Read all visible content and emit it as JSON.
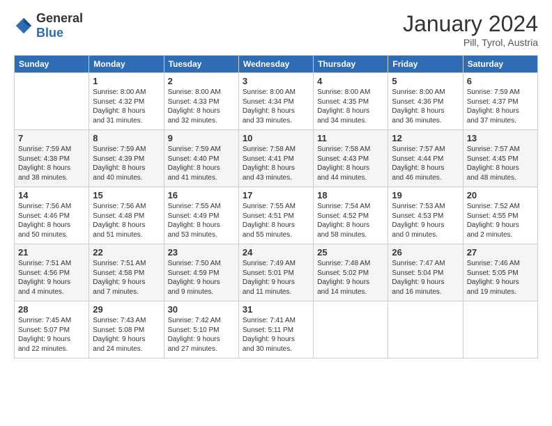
{
  "header": {
    "logo_general": "General",
    "logo_blue": "Blue",
    "month_title": "January 2024",
    "subtitle": "Pill, Tyrol, Austria"
  },
  "days_of_week": [
    "Sunday",
    "Monday",
    "Tuesday",
    "Wednesday",
    "Thursday",
    "Friday",
    "Saturday"
  ],
  "weeks": [
    [
      {
        "day": "",
        "info": ""
      },
      {
        "day": "1",
        "info": "Sunrise: 8:00 AM\nSunset: 4:32 PM\nDaylight: 8 hours\nand 31 minutes."
      },
      {
        "day": "2",
        "info": "Sunrise: 8:00 AM\nSunset: 4:33 PM\nDaylight: 8 hours\nand 32 minutes."
      },
      {
        "day": "3",
        "info": "Sunrise: 8:00 AM\nSunset: 4:34 PM\nDaylight: 8 hours\nand 33 minutes."
      },
      {
        "day": "4",
        "info": "Sunrise: 8:00 AM\nSunset: 4:35 PM\nDaylight: 8 hours\nand 34 minutes."
      },
      {
        "day": "5",
        "info": "Sunrise: 8:00 AM\nSunset: 4:36 PM\nDaylight: 8 hours\nand 36 minutes."
      },
      {
        "day": "6",
        "info": "Sunrise: 7:59 AM\nSunset: 4:37 PM\nDaylight: 8 hours\nand 37 minutes."
      }
    ],
    [
      {
        "day": "7",
        "info": "Sunrise: 7:59 AM\nSunset: 4:38 PM\nDaylight: 8 hours\nand 38 minutes."
      },
      {
        "day": "8",
        "info": "Sunrise: 7:59 AM\nSunset: 4:39 PM\nDaylight: 8 hours\nand 40 minutes."
      },
      {
        "day": "9",
        "info": "Sunrise: 7:59 AM\nSunset: 4:40 PM\nDaylight: 8 hours\nand 41 minutes."
      },
      {
        "day": "10",
        "info": "Sunrise: 7:58 AM\nSunset: 4:41 PM\nDaylight: 8 hours\nand 43 minutes."
      },
      {
        "day": "11",
        "info": "Sunrise: 7:58 AM\nSunset: 4:43 PM\nDaylight: 8 hours\nand 44 minutes."
      },
      {
        "day": "12",
        "info": "Sunrise: 7:57 AM\nSunset: 4:44 PM\nDaylight: 8 hours\nand 46 minutes."
      },
      {
        "day": "13",
        "info": "Sunrise: 7:57 AM\nSunset: 4:45 PM\nDaylight: 8 hours\nand 48 minutes."
      }
    ],
    [
      {
        "day": "14",
        "info": "Sunrise: 7:56 AM\nSunset: 4:46 PM\nDaylight: 8 hours\nand 50 minutes."
      },
      {
        "day": "15",
        "info": "Sunrise: 7:56 AM\nSunset: 4:48 PM\nDaylight: 8 hours\nand 51 minutes."
      },
      {
        "day": "16",
        "info": "Sunrise: 7:55 AM\nSunset: 4:49 PM\nDaylight: 8 hours\nand 53 minutes."
      },
      {
        "day": "17",
        "info": "Sunrise: 7:55 AM\nSunset: 4:51 PM\nDaylight: 8 hours\nand 55 minutes."
      },
      {
        "day": "18",
        "info": "Sunrise: 7:54 AM\nSunset: 4:52 PM\nDaylight: 8 hours\nand 58 minutes."
      },
      {
        "day": "19",
        "info": "Sunrise: 7:53 AM\nSunset: 4:53 PM\nDaylight: 9 hours\nand 0 minutes."
      },
      {
        "day": "20",
        "info": "Sunrise: 7:52 AM\nSunset: 4:55 PM\nDaylight: 9 hours\nand 2 minutes."
      }
    ],
    [
      {
        "day": "21",
        "info": "Sunrise: 7:51 AM\nSunset: 4:56 PM\nDaylight: 9 hours\nand 4 minutes."
      },
      {
        "day": "22",
        "info": "Sunrise: 7:51 AM\nSunset: 4:58 PM\nDaylight: 9 hours\nand 7 minutes."
      },
      {
        "day": "23",
        "info": "Sunrise: 7:50 AM\nSunset: 4:59 PM\nDaylight: 9 hours\nand 9 minutes."
      },
      {
        "day": "24",
        "info": "Sunrise: 7:49 AM\nSunset: 5:01 PM\nDaylight: 9 hours\nand 11 minutes."
      },
      {
        "day": "25",
        "info": "Sunrise: 7:48 AM\nSunset: 5:02 PM\nDaylight: 9 hours\nand 14 minutes."
      },
      {
        "day": "26",
        "info": "Sunrise: 7:47 AM\nSunset: 5:04 PM\nDaylight: 9 hours\nand 16 minutes."
      },
      {
        "day": "27",
        "info": "Sunrise: 7:46 AM\nSunset: 5:05 PM\nDaylight: 9 hours\nand 19 minutes."
      }
    ],
    [
      {
        "day": "28",
        "info": "Sunrise: 7:45 AM\nSunset: 5:07 PM\nDaylight: 9 hours\nand 22 minutes."
      },
      {
        "day": "29",
        "info": "Sunrise: 7:43 AM\nSunset: 5:08 PM\nDaylight: 9 hours\nand 24 minutes."
      },
      {
        "day": "30",
        "info": "Sunrise: 7:42 AM\nSunset: 5:10 PM\nDaylight: 9 hours\nand 27 minutes."
      },
      {
        "day": "31",
        "info": "Sunrise: 7:41 AM\nSunset: 5:11 PM\nDaylight: 9 hours\nand 30 minutes."
      },
      {
        "day": "",
        "info": ""
      },
      {
        "day": "",
        "info": ""
      },
      {
        "day": "",
        "info": ""
      }
    ]
  ]
}
